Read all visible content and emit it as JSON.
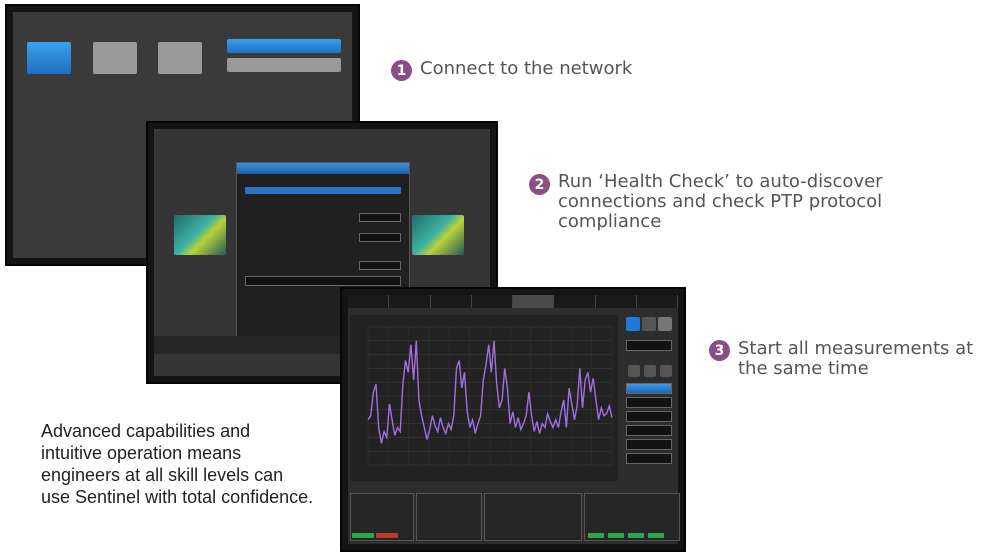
{
  "steps": [
    {
      "number": "1",
      "text": "Connect to the network"
    },
    {
      "number": "2",
      "text": "Run ‘Health Check’ to auto-discover connections and check PTP protocol compliance"
    },
    {
      "number": "3",
      "text": "Start all measurements at the same time"
    }
  ],
  "description": "Advanced capabilities and intuitive operation means engineers at all skill levels can use Sentinel with total confidence.",
  "colors": {
    "accent_purple": "#8a4d86",
    "caption_text": "#555555",
    "ui_blue": "#2a7fd6",
    "plot_trace": "#a070e0"
  },
  "screen3": {
    "trace_values": [
      -1.2,
      -1.0,
      0.2,
      0.6,
      -1.6,
      -2.4,
      -1.8,
      -2.1,
      -0.4,
      -1.2,
      -2.0,
      -1.6,
      -1.8,
      0.6,
      1.8,
      1.2,
      2.6,
      0.8,
      2.8,
      -0.2,
      -1.0,
      -1.6,
      -2.2,
      -1.7,
      -1.0,
      -1.5,
      -1.8,
      -1.1,
      -1.6,
      -1.9,
      -1.4,
      -1.7,
      -1.0,
      1.4,
      1.8,
      0.4,
      1.2,
      -0.8,
      -1.6,
      -1.2,
      -1.9,
      -1.4,
      -1.0,
      0.8,
      1.6,
      2.6,
      1.2,
      2.8,
      0.6,
      -0.6,
      -0.2,
      1.4,
      0.4,
      -1.4,
      -0.8,
      -1.6,
      -1.1,
      -1.7,
      -1.4,
      -1.0,
      0.2,
      -1.0,
      -1.8,
      -1.3,
      -1.9,
      -1.4,
      -1.6,
      -0.9,
      -1.3,
      -1.6,
      -1.2,
      -1.6,
      -0.8,
      -0.2,
      -1.6,
      0.4,
      -0.4,
      -1.2,
      -0.5,
      1.4,
      -0.6,
      0.8,
      1.2,
      0.2,
      0.9,
      -0.2,
      -1.2,
      -0.6,
      -1.0,
      -0.9,
      -0.5,
      -1.1
    ],
    "y_range": [
      -3.5,
      3.5
    ]
  }
}
